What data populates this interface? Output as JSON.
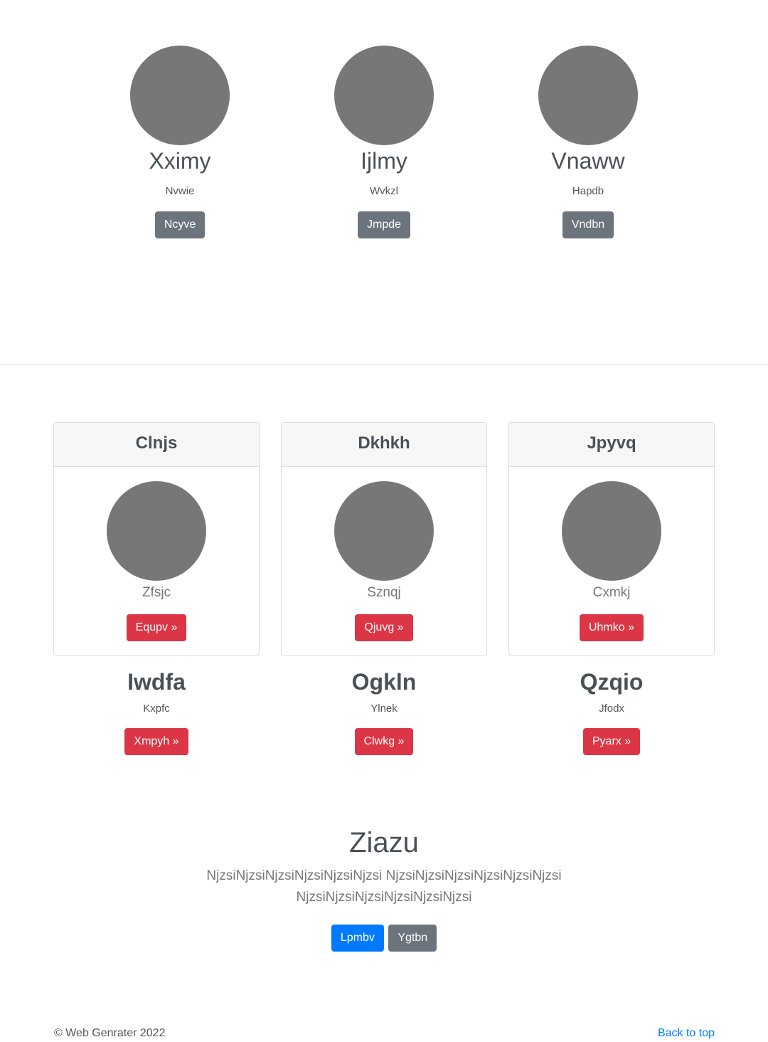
{
  "profiles": [
    {
      "name": "Xximy",
      "subtitle": "Nvwie",
      "button": "Ncyve"
    },
    {
      "name": "Ijlmy",
      "subtitle": "Wvkzl",
      "button": "Jmpde"
    },
    {
      "name": "Vnaww",
      "subtitle": "Hapdb",
      "button": "Vndbn"
    }
  ],
  "cards": [
    {
      "header": "Clnjs",
      "caption": "Zfsjc",
      "button": "Equpv »"
    },
    {
      "header": "Dkhkh",
      "caption": "Sznqj",
      "button": "Qjuvg »"
    },
    {
      "header": "Jpyvq",
      "caption": "Cxmkj",
      "button": "Uhmko »"
    }
  ],
  "features": [
    {
      "title": "Iwdfa",
      "subtitle": "Kxpfc",
      "button": "Xmpyh »"
    },
    {
      "title": "Ogkln",
      "subtitle": "Ylnek",
      "button": "Clwkg »"
    },
    {
      "title": "Qzqio",
      "subtitle": "Jfodx",
      "button": "Pyarx »"
    }
  ],
  "hero": {
    "heading": "Ziazu",
    "lead": "NjzsiNjzsiNjzsiNjzsiNjzsiNjzsi NjzsiNjzsiNjzsiNjzsiNjzsiNjzsi NjzsiNjzsiNjzsiNjzsiNjzsiNjzsi",
    "primary_button": "Lpmbv",
    "secondary_button": "Ygtbn"
  },
  "footer": {
    "copyright": "© Web Genrater 2022",
    "back_to_top": "Back to top"
  },
  "colors": {
    "avatar": "#777777",
    "secondary": "#6c757d",
    "danger": "#dc3545",
    "primary": "#007bff"
  }
}
